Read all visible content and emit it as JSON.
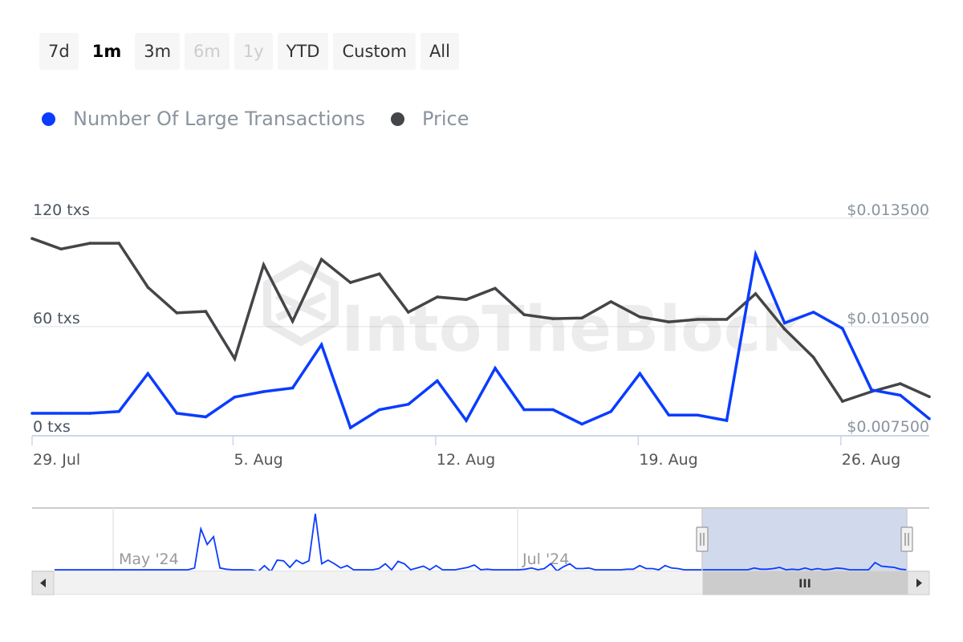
{
  "range_selector": {
    "buttons": [
      {
        "label": "7d",
        "state": "normal"
      },
      {
        "label": "1m",
        "state": "active"
      },
      {
        "label": "3m",
        "state": "normal"
      },
      {
        "label": "6m",
        "state": "disabled"
      },
      {
        "label": "1y",
        "state": "disabled"
      },
      {
        "label": "YTD",
        "state": "normal"
      },
      {
        "label": "Custom",
        "state": "normal"
      },
      {
        "label": "All",
        "state": "normal"
      }
    ]
  },
  "legend": {
    "items": [
      {
        "label": "Number Of Large Transactions",
        "color": "#0a3cff"
      },
      {
        "label": "Price",
        "color": "#434548"
      }
    ]
  },
  "watermark": "IntoTheBlock",
  "chart_data": {
    "type": "line",
    "title": "",
    "x": [
      "29 Jul",
      "30 Jul",
      "31 Jul",
      "1 Aug",
      "2 Aug",
      "3 Aug",
      "4 Aug",
      "5 Aug",
      "6 Aug",
      "7 Aug",
      "8 Aug",
      "9 Aug",
      "10 Aug",
      "11 Aug",
      "12 Aug",
      "13 Aug",
      "14 Aug",
      "15 Aug",
      "16 Aug",
      "17 Aug",
      "18 Aug",
      "19 Aug",
      "20 Aug",
      "21 Aug",
      "22 Aug",
      "23 Aug",
      "24 Aug",
      "25 Aug",
      "26 Aug",
      "27 Aug",
      "28 Aug",
      "29 Aug"
    ],
    "x_tick_labels": [
      "29. Jul",
      "5. Aug",
      "12. Aug",
      "19. Aug",
      "26. Aug"
    ],
    "x_tick_indices": [
      0,
      7,
      14,
      21,
      28
    ],
    "series": [
      {
        "name": "Number Of Large Transactions",
        "axis": "left",
        "color": "#0a3cff",
        "values": [
          12,
          12,
          12,
          13,
          34,
          12,
          10,
          21,
          24,
          26,
          50,
          4,
          14,
          17,
          30,
          8,
          37,
          14,
          14,
          6,
          13,
          34,
          11,
          11,
          8,
          100,
          62,
          68,
          59,
          25,
          22,
          9
        ]
      },
      {
        "name": "Price",
        "axis": "right",
        "color": "#434548",
        "values": [
          0.01294,
          0.01265,
          0.01281,
          0.01281,
          0.01159,
          0.01088,
          0.01092,
          0.00961,
          0.01221,
          0.01065,
          0.01236,
          0.01172,
          0.01196,
          0.0109,
          0.01132,
          0.01125,
          0.01156,
          0.01083,
          0.01072,
          0.01074,
          0.01119,
          0.01077,
          0.01063,
          0.0107,
          0.0107,
          0.01141,
          0.01043,
          0.00965,
          0.00843,
          0.0087,
          0.00892,
          0.00856
        ]
      }
    ],
    "y_left": {
      "label": "",
      "ticks": [
        "0 txs",
        "60 txs",
        "120 txs"
      ],
      "tick_values": [
        0,
        60,
        120
      ],
      "range": [
        0,
        120
      ]
    },
    "y_right": {
      "label": "",
      "ticks": [
        "$0.007500",
        "$0.010500",
        "$0.013500"
      ],
      "tick_values": [
        0.0075,
        0.0105,
        0.0135
      ],
      "range": [
        0.0075,
        0.0135
      ]
    },
    "grid": true,
    "legend_position": "top-left"
  },
  "navigator": {
    "labels": [
      "May '24",
      "Jul '24"
    ],
    "values": [
      0,
      0,
      0,
      0,
      0,
      0,
      0,
      0,
      0,
      0,
      0,
      0,
      0,
      0,
      0,
      0,
      0,
      0,
      0,
      0,
      0,
      0,
      3,
      68,
      42,
      55,
      3,
      1,
      0,
      0,
      0,
      0,
      -3,
      7,
      -3,
      16,
      15,
      4,
      16,
      10,
      15,
      93,
      10,
      16,
      10,
      3,
      7,
      0,
      0,
      0,
      0,
      2,
      10,
      0,
      14,
      10,
      0,
      3,
      6,
      0,
      7,
      0,
      0,
      0,
      2,
      4,
      8,
      0,
      1,
      0,
      0,
      0,
      0,
      0,
      1,
      3,
      0,
      2,
      10,
      -2,
      5,
      10,
      2,
      2,
      3,
      0,
      0,
      0,
      0,
      0,
      1,
      1,
      7,
      2,
      2,
      0,
      7,
      3,
      2,
      0,
      0,
      0,
      0,
      0,
      0,
      0,
      0,
      0,
      0,
      0,
      3,
      1,
      1,
      2,
      4,
      0,
      1,
      0,
      3,
      0,
      2,
      0,
      1,
      3,
      2,
      0,
      0,
      0,
      0,
      12,
      6,
      5,
      4,
      1,
      0
    ],
    "selected_range": [
      "29 Jul",
      "29 Aug"
    ]
  },
  "scrollbar": {
    "left_arrow": "scroll-left-arrow",
    "right_arrow": "scroll-right-arrow",
    "grip": "III"
  }
}
